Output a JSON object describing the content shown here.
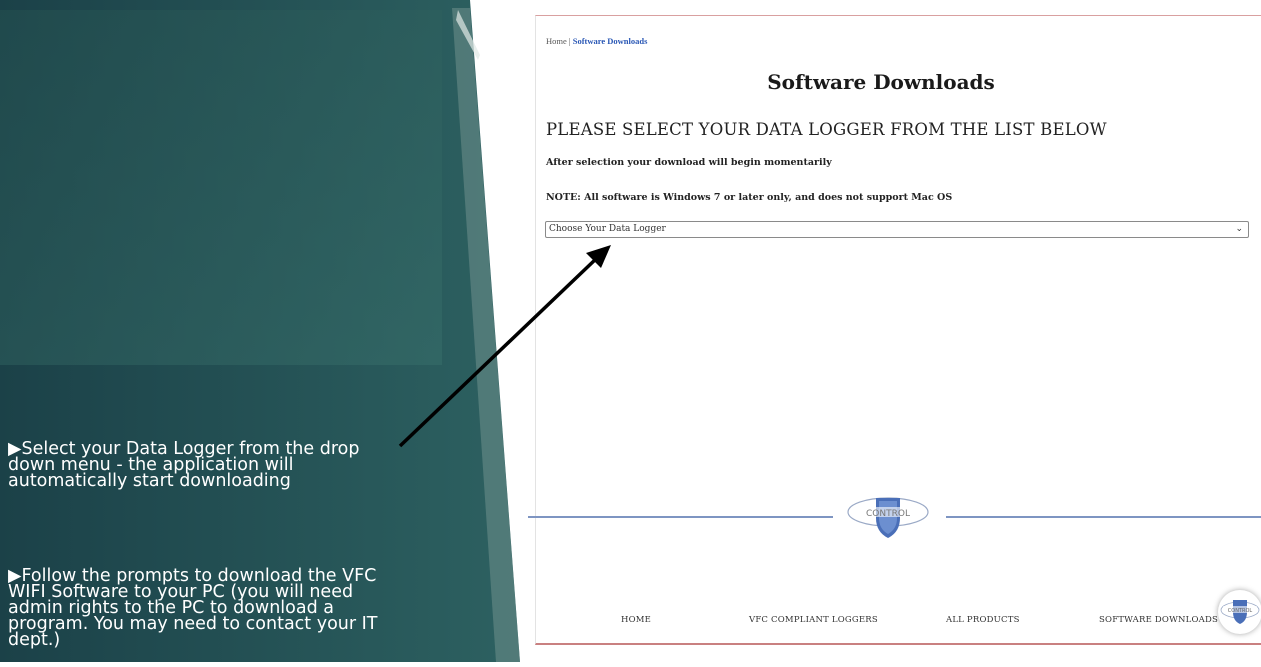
{
  "slide": {
    "bullet1": "▶Select your Data Logger from the drop down menu - the application will automatically start downloading",
    "bullet2": "▶Follow the prompts to download the VFC WIFI Software to your PC (you will need admin rights to the PC to download a program. You may need to contact your IT dept.)",
    "colors": {
      "panel_dark": "#1b4148",
      "panel_teal": "#2b5d5d",
      "text": "#ffffff"
    }
  },
  "webpage": {
    "breadcrumb": {
      "home": "Home",
      "separator": "|",
      "current": "Software Downloads"
    },
    "title": "Software Downloads",
    "heading": "PLEASE SELECT YOUR DATA LOGGER FROM THE LIST BELOW",
    "note_selection": "After selection your download will begin momentarily",
    "note_os": "NOTE: All software is Windows 7 or later only, and does not support Mac OS",
    "logger_select": {
      "selected": "Choose Your Data Logger",
      "icon": "chevron-down-icon"
    },
    "logo_text": "CONTROL",
    "footer_nav": [
      {
        "label": "HOME"
      },
      {
        "label": "VFC COMPLIANT LOGGERS"
      },
      {
        "label": "ALL PRODUCTS"
      },
      {
        "label": "SOFTWARE DOWNLOADS"
      }
    ],
    "chat_logo_text": "CONTROL",
    "colors": {
      "link": "#2957b5",
      "footer_line": "#7e95c2",
      "logo_shield": "#4a6fb8"
    }
  }
}
